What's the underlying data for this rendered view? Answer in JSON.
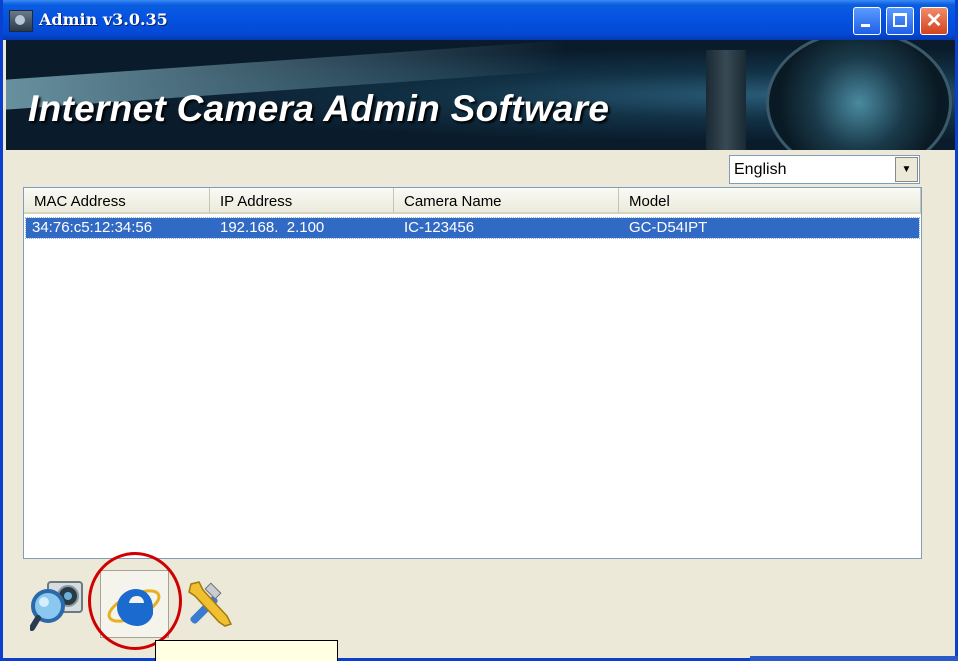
{
  "window": {
    "title": "Admin v3.0.35",
    "app_icon": "camera-app-icon",
    "controls": {
      "minimize": "minimize-icon",
      "maximize": "maximize-icon",
      "close": "close-icon"
    }
  },
  "banner": {
    "title": "Internet Camera Admin Software"
  },
  "language": {
    "selected": "English"
  },
  "table": {
    "columns": [
      "MAC Address",
      "IP Address",
      "Camera Name",
      "Model"
    ],
    "rows": [
      {
        "mac": "34:76:c5:12:34:56",
        "ip": "192.168.  2.100",
        "name": "IC-123456",
        "model": "GC-D54IPT",
        "selected": true
      }
    ]
  },
  "toolbar": {
    "icons": [
      "search-camera-icon",
      "internet-explorer-icon",
      "tools-icon"
    ],
    "highlighted": "internet-explorer-icon"
  },
  "colors": {
    "selection": "#316ac5",
    "titlebar": "#0451e0",
    "highlight_circle": "#d00000"
  }
}
